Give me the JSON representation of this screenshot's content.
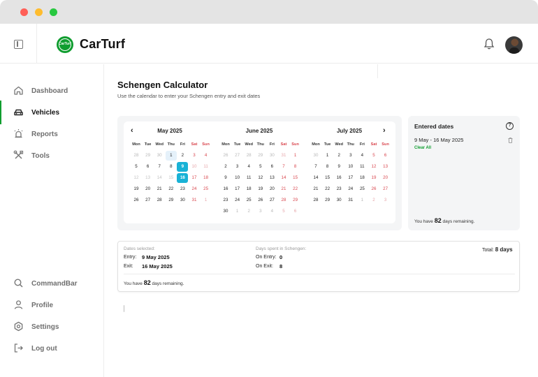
{
  "app": {
    "brand": "CarTurf",
    "logo_text": "CarTurf"
  },
  "sidebar": {
    "items": [
      {
        "label": "Dashboard",
        "icon": "home-icon"
      },
      {
        "label": "Vehicles",
        "icon": "car-icon"
      },
      {
        "label": "Reports",
        "icon": "alarm-light-icon"
      },
      {
        "label": "Tools",
        "icon": "tools-icon"
      },
      {
        "label": "CommandBar",
        "icon": "search-icon"
      },
      {
        "label": "Profile",
        "icon": "user-icon"
      },
      {
        "label": "Settings",
        "icon": "gear-icon"
      },
      {
        "label": "Log out",
        "icon": "logout-icon"
      }
    ],
    "active": "Vehicles"
  },
  "page": {
    "title": "Schengen Calculator",
    "subtitle": "Use the calendar to enter your Schengen entry and exit dates"
  },
  "calendar": {
    "weekdays": [
      "Mon",
      "Tue",
      "Wed",
      "Thu",
      "Fri",
      "Sat",
      "Sun"
    ],
    "months": [
      {
        "title": "May 2025",
        "weeks": [
          [
            "28",
            "29",
            "30",
            "1",
            "2",
            "3",
            "4"
          ],
          [
            "5",
            "6",
            "7",
            "8",
            "9",
            "10",
            "11"
          ],
          [
            "12",
            "13",
            "14",
            "15",
            "16",
            "17",
            "18"
          ],
          [
            "19",
            "20",
            "21",
            "22",
            "23",
            "24",
            "25"
          ],
          [
            "26",
            "27",
            "28",
            "29",
            "30",
            "31",
            "1"
          ]
        ]
      },
      {
        "title": "June 2025",
        "weeks": [
          [
            "26",
            "27",
            "28",
            "29",
            "30",
            "31",
            "1"
          ],
          [
            "2",
            "3",
            "4",
            "5",
            "6",
            "7",
            "8"
          ],
          [
            "9",
            "10",
            "11",
            "12",
            "13",
            "14",
            "15"
          ],
          [
            "16",
            "17",
            "18",
            "19",
            "20",
            "21",
            "22"
          ],
          [
            "23",
            "24",
            "25",
            "26",
            "27",
            "28",
            "29"
          ],
          [
            "30",
            "1",
            "2",
            "3",
            "4",
            "5",
            "6"
          ]
        ]
      },
      {
        "title": "July 2025",
        "weeks": [
          [
            "30",
            "1",
            "2",
            "3",
            "4",
            "5",
            "6"
          ],
          [
            "7",
            "8",
            "9",
            "10",
            "11",
            "12",
            "13"
          ],
          [
            "14",
            "15",
            "16",
            "17",
            "18",
            "19",
            "20"
          ],
          [
            "21",
            "22",
            "23",
            "24",
            "25",
            "26",
            "27"
          ],
          [
            "28",
            "29",
            "30",
            "31",
            "1",
            "2",
            "3"
          ]
        ]
      }
    ],
    "prev_label": "‹",
    "next_label": "›"
  },
  "entered_dates": {
    "title": "Entered dates",
    "help_label": "?",
    "range": "9 May - 16 May 2025",
    "clear_label": "Clear All",
    "remaining_prefix": "You have",
    "remaining_days": "82",
    "remaining_suffix": "days remaining."
  },
  "summary": {
    "dates_selected_label": "Dates selected:",
    "entry_label": "Entry:",
    "entry_value": "9 May 2025",
    "exit_label": "Exit:",
    "exit_value": "16 May 2025",
    "days_spent_label": "Days spent in Schengen:",
    "on_entry_label": "On Entry:",
    "on_entry_value": "0",
    "on_exit_label": "On Exit:",
    "on_exit_value": "8",
    "total_label": "Total:",
    "total_value": "8 days",
    "remaining_prefix": "You have",
    "remaining_days": "82",
    "remaining_suffix": "days remaining."
  },
  "colors": {
    "brand": "#0f9d2f",
    "selected": "#19b2d6",
    "weekend": "#d9464e"
  }
}
